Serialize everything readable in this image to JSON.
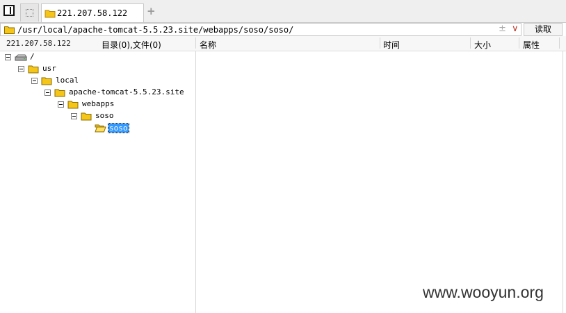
{
  "tab": {
    "title": "221.207.58.122",
    "add_symbol": "+"
  },
  "address": {
    "path": "/usr/local/apache-tomcat-5.5.23.site/webapps/soso/soso/",
    "pin_symbol": "±",
    "dropdown_symbol": "∨",
    "read_label": "读取"
  },
  "header": {
    "host": "221.207.58.122",
    "counts": "目录(0),文件(0)",
    "columns": {
      "name": "名称",
      "time": "时间",
      "size": "大小",
      "attr": "属性"
    }
  },
  "tree": {
    "root": "/",
    "usr": "usr",
    "local": "local",
    "tomcat": "apache-tomcat-5.5.23.site",
    "webapps": "webapps",
    "soso": "soso",
    "soso_child": "soso"
  },
  "watermark": "www.wooyun.org",
  "colors": {
    "folder": "#f5c518",
    "selection": "#3399ff"
  }
}
